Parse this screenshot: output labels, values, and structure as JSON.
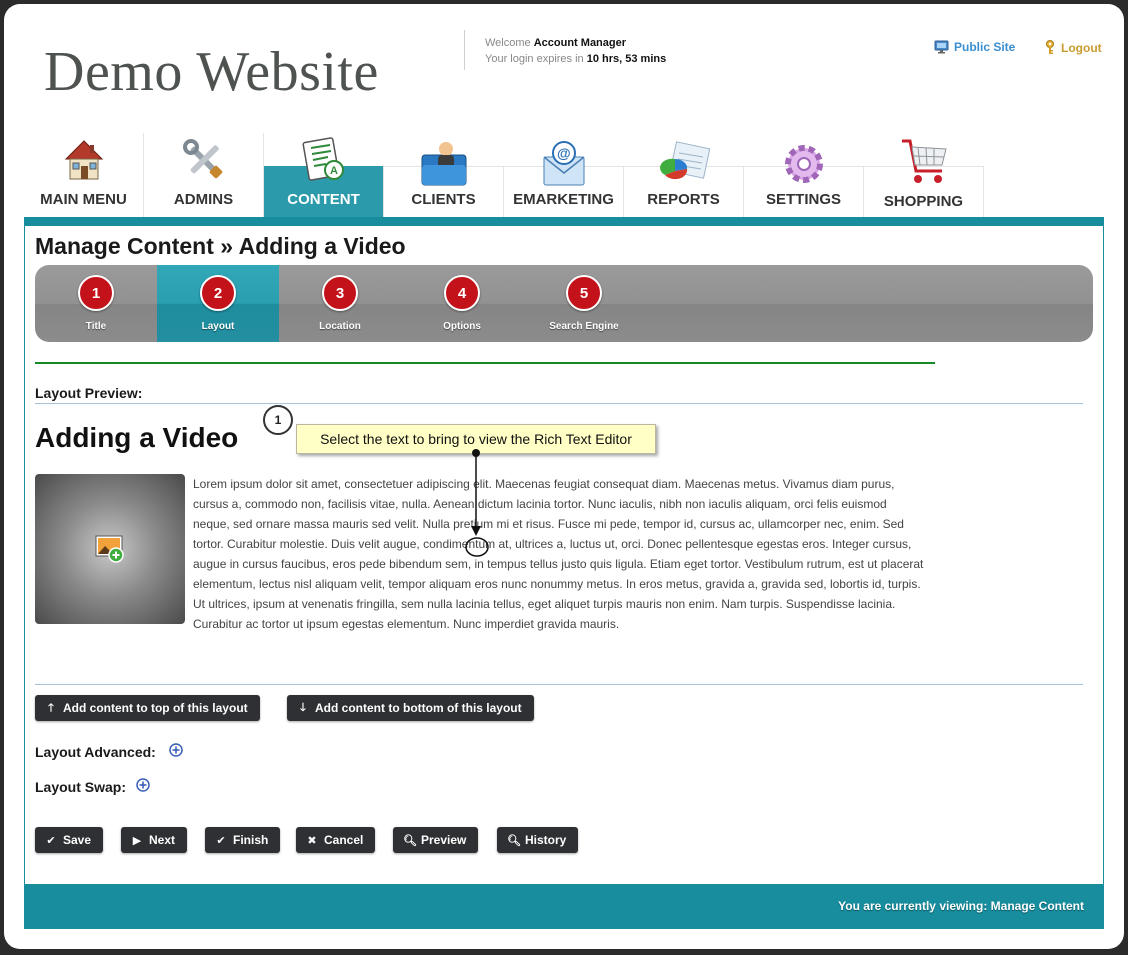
{
  "header": {
    "site_name": "Demo Website",
    "welcome_prefix": "Welcome",
    "user": "Account Manager",
    "expires_prefix": "Your login expires in",
    "expires_value": "10 hrs, 53 mins",
    "public_site": "Public Site",
    "logout": "Logout"
  },
  "tabs": [
    {
      "label": "MAIN MENU",
      "icon": "house-icon"
    },
    {
      "label": "ADMINS",
      "icon": "tools-icon"
    },
    {
      "label": "CONTENT",
      "icon": "document-icon"
    },
    {
      "label": "CLIENTS",
      "icon": "client-folder-icon"
    },
    {
      "label": "EMARKETING",
      "icon": "email-icon"
    },
    {
      "label": "REPORTS",
      "icon": "pie-chart-icon"
    },
    {
      "label": "SETTINGS",
      "icon": "gear-icon"
    },
    {
      "label": "SHOPPING",
      "icon": "shopping-cart-icon"
    }
  ],
  "page_title": "Manage Content » Adding a Video",
  "steps": [
    {
      "num": "1",
      "label": "Title"
    },
    {
      "num": "2",
      "label": "Layout"
    },
    {
      "num": "3",
      "label": "Location"
    },
    {
      "num": "4",
      "label": "Options"
    },
    {
      "num": "5",
      "label": "Search Engine"
    }
  ],
  "preview": {
    "label": "Layout Preview:",
    "heading": "Adding a Video",
    "callout_number": "1",
    "callout_text": "Select the text to bring to view the Rich Text Editor",
    "body": "Lorem ipsum dolor sit amet, consectetuer adipiscing elit. Maecenas feugiat consequat diam. Maecenas metus. Vivamus diam purus, cursus a, commodo non, facilisis vitae, nulla. Aenean dictum lacinia tortor. Nunc iaculis, nibh non iaculis aliquam, orci felis euismod neque, sed ornare massa mauris sed velit. Nulla pretium mi et risus. Fusce mi pede, tempor id, cursus ac, ullamcorper nec, enim. Sed tortor. Curabitur molestie. Duis velit augue, condimentum at, ultrices a, luctus ut, orci. Donec pellentesque egestas eros. Integer cursus, augue in cursus faucibus, eros pede bibendum sem, in tempus tellus justo quis ligula. Etiam eget tortor. Vestibulum rutrum, est ut placerat elementum, lectus nisl aliquam velit, tempor aliquam eros nunc nonummy metus. In eros metus, gravida a, gravida sed, lobortis id, turpis. Ut ultrices, ipsum at venenatis fringilla, sem nulla lacinia tellus, eget aliquet turpis mauris non enim. Nam turpis. Suspendisse lacinia. Curabitur ac tortor ut ipsum egestas elementum. Nunc imperdiet gravida mauris."
  },
  "layout_buttons": {
    "add_top": "Add content to top of this layout",
    "add_bottom": "Add content to bottom of this layout"
  },
  "layout_advanced": "Layout Advanced:",
  "layout_swap": "Layout Swap:",
  "actions": {
    "save": "Save",
    "next": "Next",
    "finish": "Finish",
    "cancel": "Cancel",
    "preview": "Preview",
    "history": "History"
  },
  "footer": {
    "status": "You are currently viewing: Manage Content"
  },
  "colors": {
    "accent": "#178d9e",
    "step_badge": "#c4121a",
    "divider_green": "#178a26",
    "button_dark": "#2e3033"
  }
}
